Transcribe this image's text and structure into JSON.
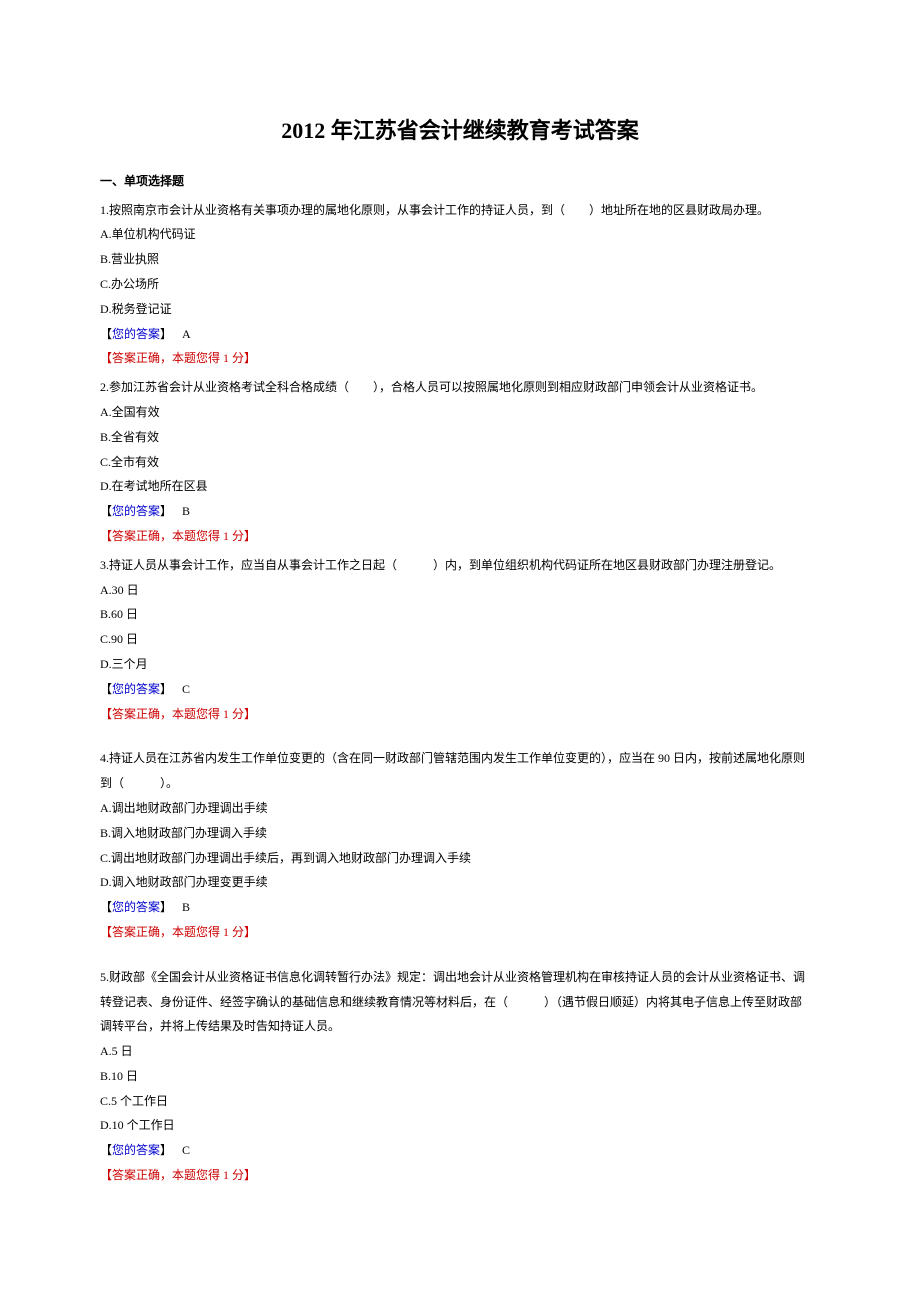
{
  "title": "2012 年江苏省会计继续教育考试答案",
  "section_header": "一、单项选择题",
  "answer_label": "您的答案",
  "correct_template": "【答案正确，本题您得 1 分】",
  "questions": [
    {
      "stem": "1.按照南京市会计从业资格有关事项办理的属地化原则，从事会计工作的持证人员，到（　　）地址所在地的区县财政局办理。",
      "options": [
        "A.单位机构代码证",
        "B.营业执照",
        "C.办公场所",
        "D.税务登记证"
      ],
      "your_answer": "A"
    },
    {
      "stem": "2.参加江苏省会计从业资格考试全科合格成绩（　　），合格人员可以按照属地化原则到相应财政部门申领会计从业资格证书。",
      "options": [
        "A.全国有效",
        "B.全省有效",
        "C.全市有效",
        "D.在考试地所在区县"
      ],
      "your_answer": "B"
    },
    {
      "stem": "3.持证人员从事会计工作，应当自从事会计工作之日起（　　　）内，到单位组织机构代码证所在地区县财政部门办理注册登记。",
      "options": [
        "A.30 日",
        "B.60 日",
        "C.90 日",
        "D.三个月"
      ],
      "your_answer": "C"
    },
    {
      "stem_lines": [
        "4.持证人员在江苏省内发生工作单位变更的（含在同一财政部门管辖范围内发生工作单位变更的），应当在 90 日内，按前述属地化原则",
        "到（　　　）。"
      ],
      "options": [
        "A.调出地财政部门办理调出手续",
        "B.调入地财政部门办理调入手续",
        "C.调出地财政部门办理调出手续后，再到调入地财政部门办理调入手续",
        "D.调入地财政部门办理变更手续"
      ],
      "your_answer": "B"
    },
    {
      "stem_lines": [
        "5.财政部《全国会计从业资格证书信息化调转暂行办法》规定：调出地会计从业资格管理机构在审核持证人员的会计从业资格证书、调",
        "转登记表、身份证件、经签字确认的基础信息和继续教育情况等材料后，在（　　　）（遇节假日顺延）内将其电子信息上传至财政部",
        "调转平台，并将上传结果及时告知持证人员。"
      ],
      "options": [
        "A.5 日",
        "B.10 日",
        "C.5 个工作日",
        "D.10 个工作日"
      ],
      "your_answer": "C"
    }
  ]
}
